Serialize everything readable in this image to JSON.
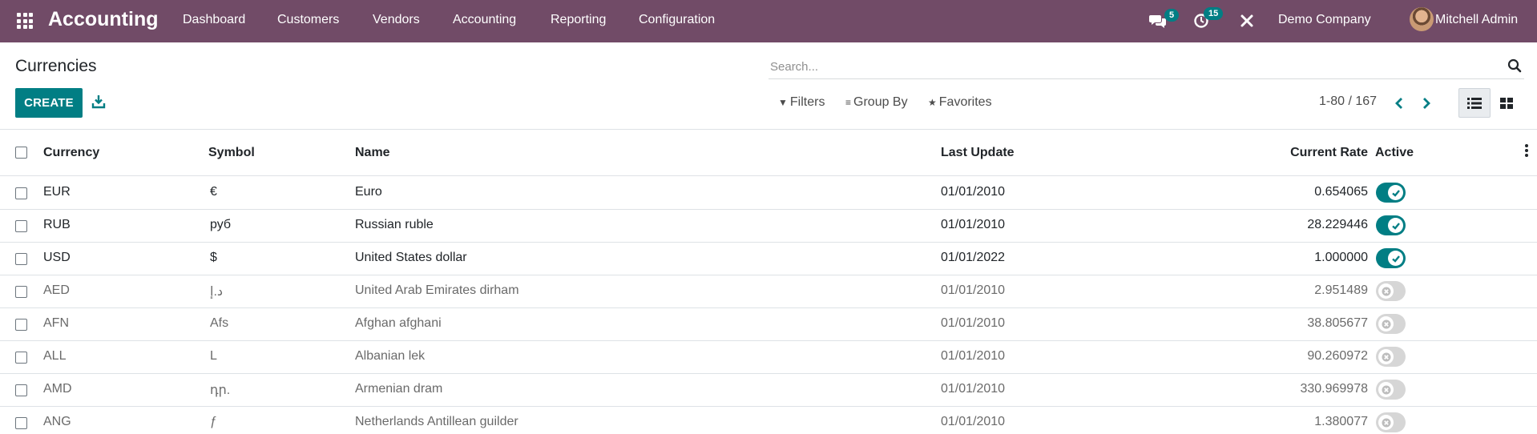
{
  "navbar": {
    "app_name": "Accounting",
    "menu": [
      "Dashboard",
      "Customers",
      "Vendors",
      "Accounting",
      "Reporting",
      "Configuration"
    ],
    "messages_badge": "5",
    "activities_badge": "15",
    "company": "Demo Company",
    "user": "Mitchell Admin",
    "brand_color": "#714b67"
  },
  "control_panel": {
    "title": "Currencies",
    "search_placeholder": "Search...",
    "create_label": "CREATE",
    "filters_label": "Filters",
    "group_by_label": "Group By",
    "favorites_label": "Favorites",
    "pager_value": "1-80 / 167",
    "accent_color": "#017e84"
  },
  "table": {
    "columns": [
      "Currency",
      "Symbol",
      "Name",
      "Last Update",
      "Current Rate",
      "Active"
    ],
    "rows": [
      {
        "currency": "EUR",
        "symbol": "€",
        "name": "Euro",
        "last_update": "01/01/2010",
        "rate": "0.654065",
        "active": true
      },
      {
        "currency": "RUB",
        "symbol": "руб",
        "name": "Russian ruble",
        "last_update": "01/01/2010",
        "rate": "28.229446",
        "active": true
      },
      {
        "currency": "USD",
        "symbol": "$",
        "name": "United States dollar",
        "last_update": "01/01/2022",
        "rate": "1.000000",
        "active": true
      },
      {
        "currency": "AED",
        "symbol": "د.إ",
        "name": "United Arab Emirates dirham",
        "last_update": "01/01/2010",
        "rate": "2.951489",
        "active": false
      },
      {
        "currency": "AFN",
        "symbol": "Afs",
        "name": "Afghan afghani",
        "last_update": "01/01/2010",
        "rate": "38.805677",
        "active": false
      },
      {
        "currency": "ALL",
        "symbol": "L",
        "name": "Albanian lek",
        "last_update": "01/01/2010",
        "rate": "90.260972",
        "active": false
      },
      {
        "currency": "AMD",
        "symbol": "դր.",
        "name": "Armenian dram",
        "last_update": "01/01/2010",
        "rate": "330.969978",
        "active": false
      },
      {
        "currency": "ANG",
        "symbol": "ƒ",
        "name": "Netherlands Antillean guilder",
        "last_update": "01/01/2010",
        "rate": "1.380077",
        "active": false
      }
    ]
  }
}
